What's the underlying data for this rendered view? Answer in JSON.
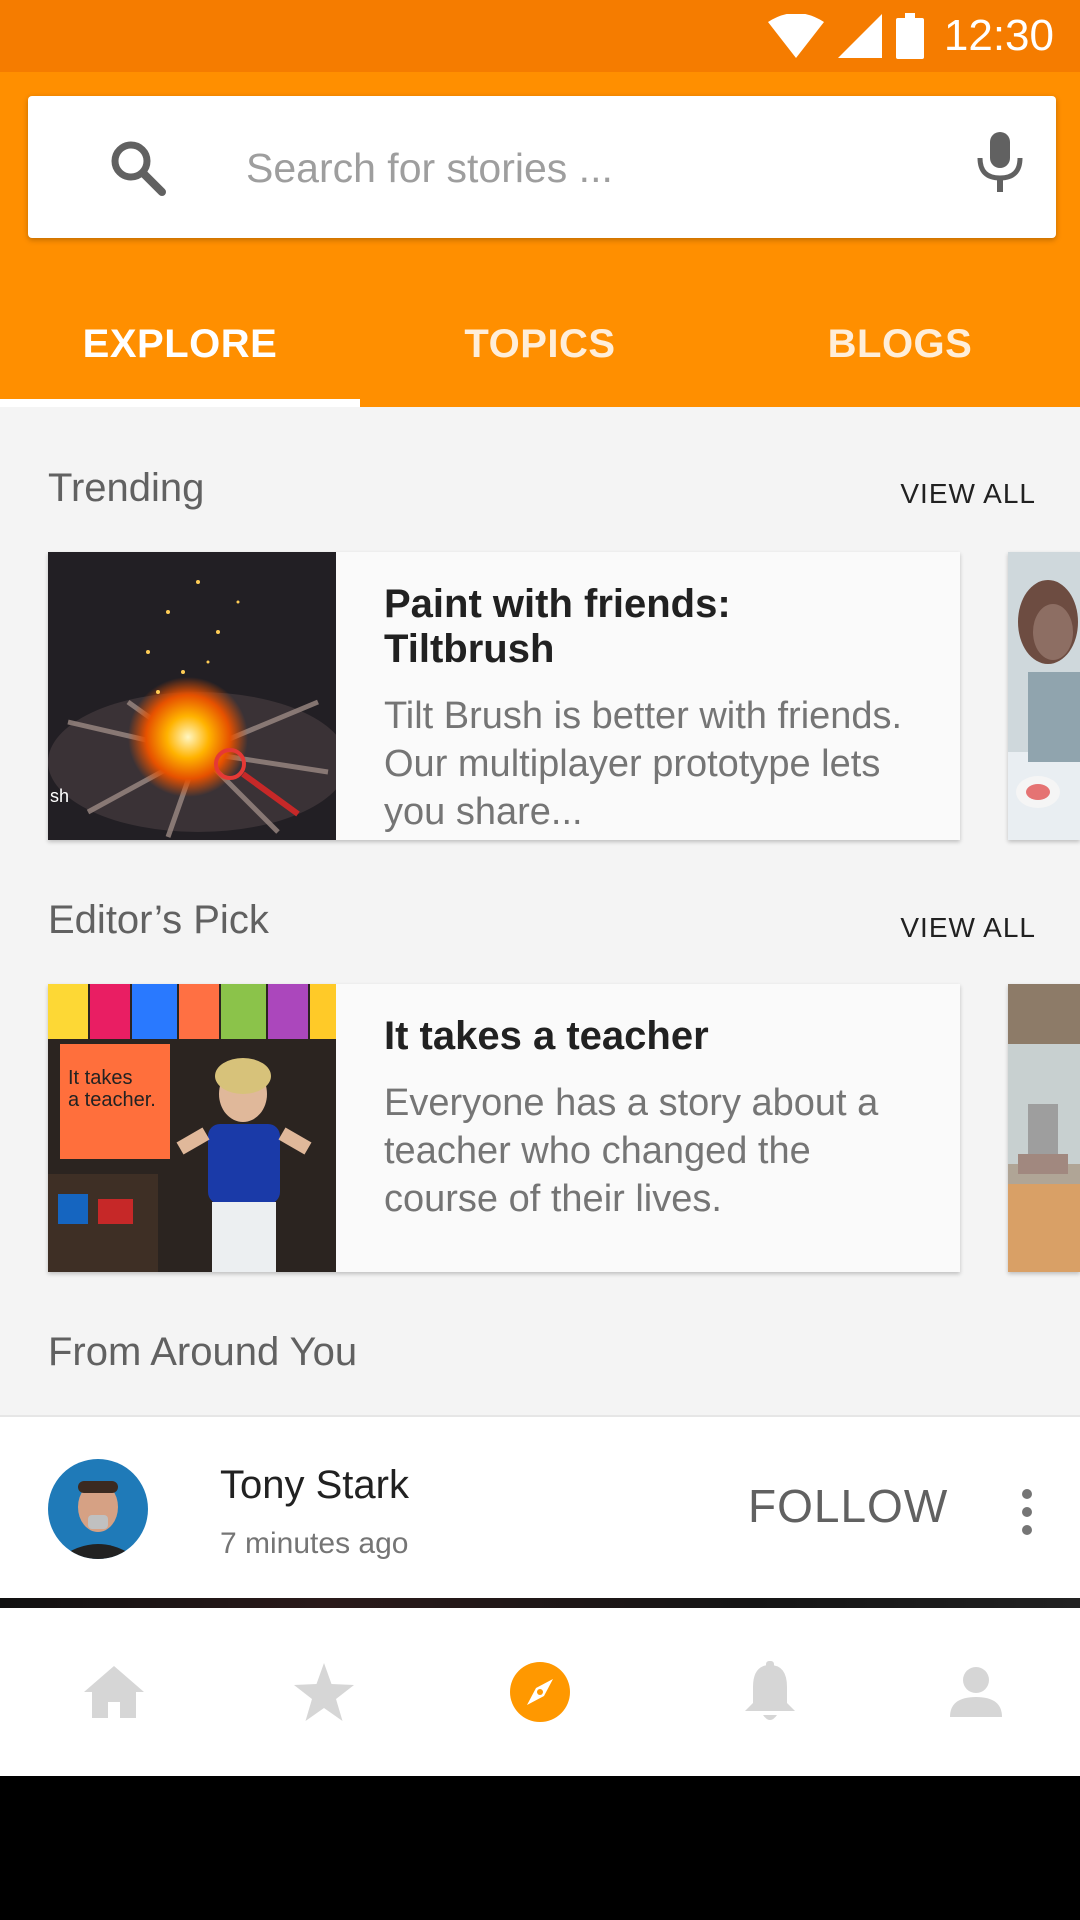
{
  "status_bar": {
    "time": "12:30",
    "icons": [
      "wifi-icon",
      "signal-icon",
      "battery-icon"
    ]
  },
  "search": {
    "placeholder": "Search for stories ...",
    "value": ""
  },
  "tabs": [
    {
      "label": "EXPLORE",
      "active": true
    },
    {
      "label": "TOPICS",
      "active": false
    },
    {
      "label": "BLOGS",
      "active": false
    }
  ],
  "trending": {
    "title": "Trending",
    "view_all": "VIEW ALL",
    "card": {
      "title": "Paint with friends: Tiltbrush",
      "text": "Tilt Brush is better with friends. Our multiplayer prototype lets you share...",
      "image_caption": "sh"
    }
  },
  "editors_pick": {
    "title": "Editor’s Pick",
    "view_all": "VIEW ALL",
    "card": {
      "title": "It takes a teacher",
      "text": "Everyone has a story about a teacher who changed the course of their lives.",
      "sign_text": "It takes a teacher."
    }
  },
  "around_you": {
    "title": "From Around You",
    "post": {
      "author": "Tony Stark",
      "time": "7 minutes ago",
      "follow": "FOLLOW"
    }
  },
  "bottom_nav": [
    "home-icon",
    "star-icon",
    "compass-icon",
    "bell-icon",
    "person-icon"
  ],
  "colors": {
    "primary": "#ff8f00",
    "status_bar": "#f57c00",
    "active_nav": "#ff9800",
    "inactive_nav": "#d6d6d6"
  }
}
